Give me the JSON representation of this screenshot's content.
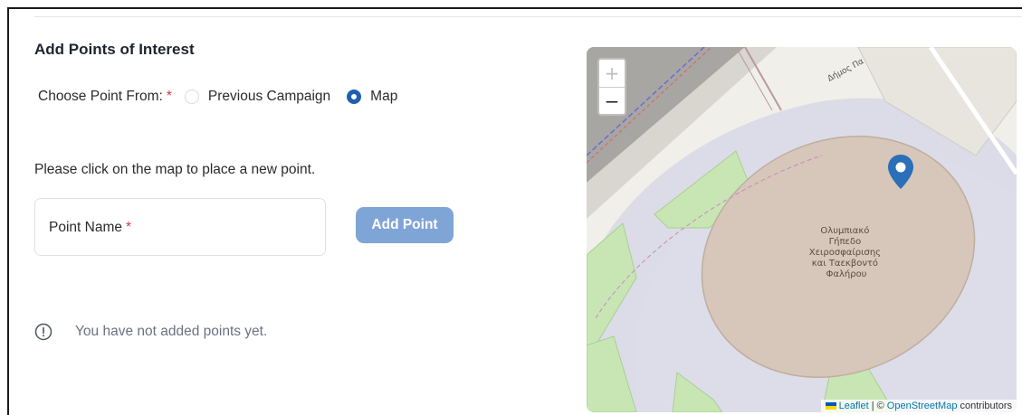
{
  "section": {
    "title": "Add Points of Interest"
  },
  "choose": {
    "label": "Choose Point From:",
    "required_mark": "*",
    "options": [
      {
        "label": "Previous Campaign",
        "selected": false
      },
      {
        "label": "Map",
        "selected": true
      }
    ]
  },
  "hint": "Please click on the map to place a new point.",
  "point_name": {
    "label": "Point Name",
    "required_mark": "*",
    "value": ""
  },
  "add_button": {
    "label": "Add Point"
  },
  "empty_state": {
    "icon": "info-circle-icon",
    "text": "You have not added points yet."
  },
  "map": {
    "zoom_in": "+",
    "zoom_out": "−",
    "place_label": [
      "Ολυμπιακό",
      "Γήπεδο",
      "Χειροσφαίρισης",
      "και Ταεκβοντό",
      "Φαλήρου"
    ],
    "street_label": "Δήμος Πα",
    "marker_icon": "map-marker-icon",
    "attribution": {
      "leaflet": "Leaflet",
      "separator": "| ©",
      "osm": "OpenStreetMap",
      "suffix": "contributors"
    }
  },
  "colors": {
    "accent": "#1f5fb0",
    "button": "#7fa5d6",
    "required": "#d9363e",
    "marker": "#2a6fb8"
  }
}
